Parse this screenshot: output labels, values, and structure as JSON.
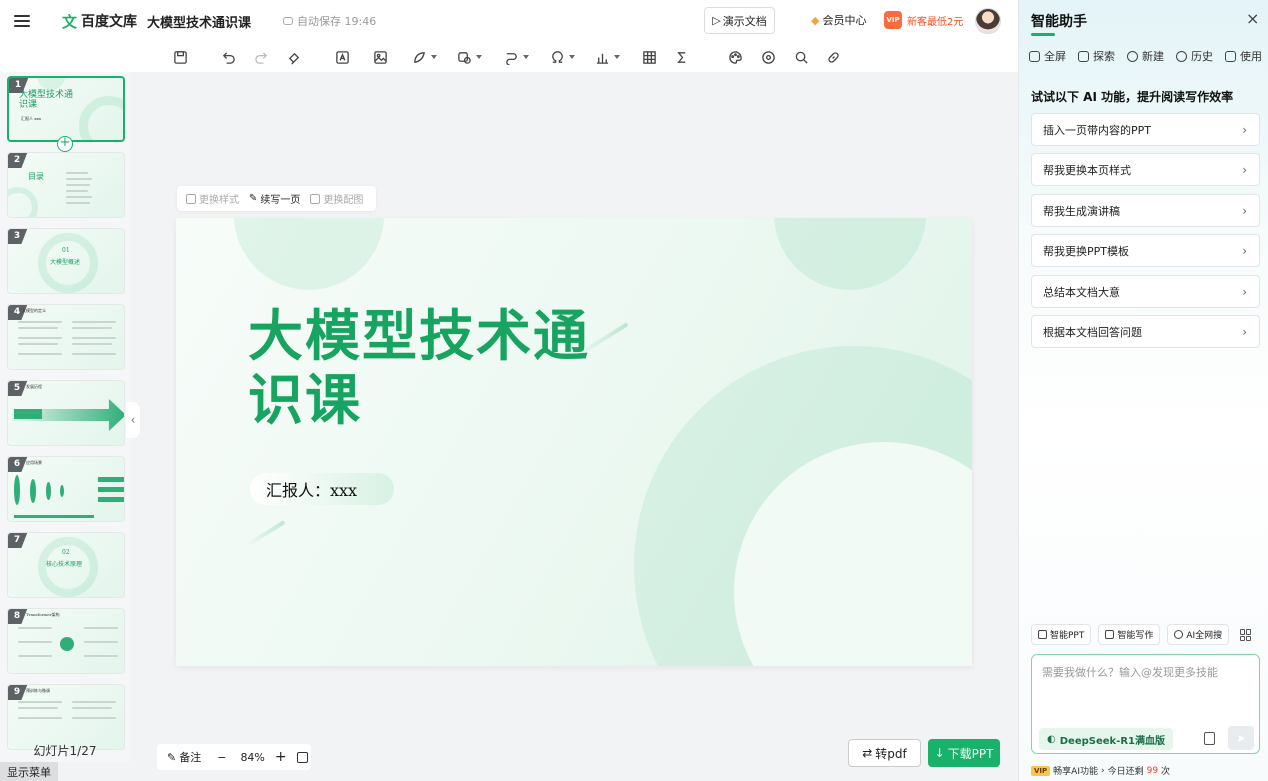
{
  "header": {
    "logo_mark": "文",
    "logo_text": "百度文库",
    "doc_title": "大模型技术通识课",
    "autosave": "自动保存 19:46",
    "present_label": "演示文档",
    "member_label": "会员中心",
    "vip_badge": "VIP",
    "promo_label": "新客最低2元"
  },
  "toolbar": {
    "icons": [
      "save-icon",
      "undo-icon",
      "redo-icon",
      "format-brush-icon",
      "textbox-icon",
      "image-icon",
      "shape-icon",
      "smartart-icon",
      "connector-icon",
      "symbol-icon",
      "chart-icon",
      "table-icon",
      "formula-icon",
      "palette-icon",
      "record-icon",
      "search-icon",
      "link-icon"
    ]
  },
  "thumbnails": {
    "slides": [
      {
        "num": "1",
        "title": "大模型技术通识课",
        "sub": "汇报人 xxx"
      },
      {
        "num": "2",
        "title": "目录"
      },
      {
        "num": "3",
        "title": "01",
        "sub": "大模型概述"
      },
      {
        "num": "4",
        "title": "大模型的定义"
      },
      {
        "num": "5",
        "title": "发展历程"
      },
      {
        "num": "6",
        "title": "应用场景"
      },
      {
        "num": "7",
        "title": "02",
        "sub": "核心技术原理"
      },
      {
        "num": "8",
        "title": "Transformer架构"
      },
      {
        "num": "9",
        "title": "预训练与微调"
      }
    ],
    "add_label": "+",
    "slide_count": "幻灯片1/27",
    "show_menu": "显示菜单",
    "collapse": "‹"
  },
  "float_bar": {
    "change_style": "更换样式",
    "continue_write": "续写一页",
    "change_image": "更换配图"
  },
  "slide": {
    "title": "大模型技术通识课",
    "reporter": "汇报人：xxx"
  },
  "bottom": {
    "notes_label": "备注",
    "zoom_out": "−",
    "zoom_level": "84%",
    "zoom_in": "+",
    "to_pdf": "转pdf",
    "download_ppt": "下载PPT"
  },
  "assistant": {
    "title": "智能助手",
    "close": "×",
    "nav": [
      "全屏",
      "探索",
      "新建",
      "历史",
      "使用"
    ],
    "heading": "试试以下 AI 功能，提升阅读写作效率",
    "items": [
      "插入一页带内容的PPT",
      "帮我更换本页样式",
      "帮我生成演讲稿",
      "帮我更换PPT模板",
      "总结本文档大意",
      "根据本文档回答问题"
    ],
    "chips": [
      "智能PPT",
      "智能写作",
      "AI全网搜"
    ],
    "input_placeholder": "需要我做什么？输入@发现更多技能",
    "model_label": "DeepSeek-R1满血版",
    "vip_tag": "VIP",
    "vip_text": "畅享AI功能",
    "remaining_prefix": "今日还剩",
    "remaining_count": "99",
    "remaining_suffix": "次"
  },
  "colors": {
    "brand_green": "#19b26a",
    "promo_red": "#ff4a1c"
  }
}
